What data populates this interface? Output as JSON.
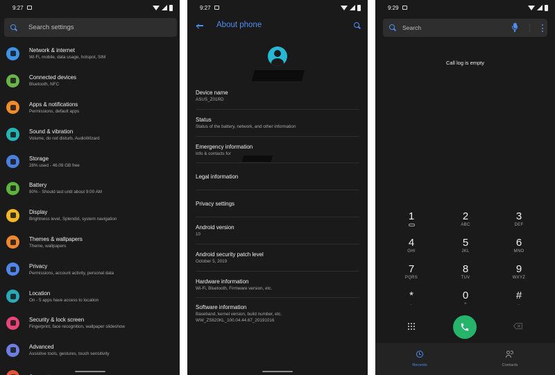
{
  "colors": {
    "background": "#1a1a1a",
    "accent": "#4d8ff0",
    "call_green": "#26b36a"
  },
  "settings_screen": {
    "status_time": "9:27",
    "search_placeholder": "Search settings",
    "items": [
      {
        "title": "Network & internet",
        "subtitle": "Wi-Fi, mobile, data usage, hotspot, SIM",
        "icon": "wifi-icon",
        "color": "#3d93e6"
      },
      {
        "title": "Connected devices",
        "subtitle": "Bluetooth, NFC",
        "icon": "devices-icon",
        "color": "#6bb34a"
      },
      {
        "title": "Apps & notifications",
        "subtitle": "Permissions, default apps",
        "icon": "apps-icon",
        "color": "#f08c2a"
      },
      {
        "title": "Sound & vibration",
        "subtitle": "Volume, do not disturb, AudioWizard",
        "icon": "volume-icon",
        "color": "#26b5b5"
      },
      {
        "title": "Storage",
        "subtitle": "28% used - 46.09 GB free",
        "icon": "storage-icon",
        "color": "#4a7fe0"
      },
      {
        "title": "Battery",
        "subtitle": "80% - Should last until about 9:00 AM",
        "icon": "battery-icon",
        "color": "#5cb63e"
      },
      {
        "title": "Display",
        "subtitle": "Brightness level, Splendid, system navigation",
        "icon": "brightness-icon",
        "color": "#f2b823"
      },
      {
        "title": "Themes & wallpapers",
        "subtitle": "Theme, wallpapers",
        "icon": "wallpaper-icon",
        "color": "#f0862e"
      },
      {
        "title": "Privacy",
        "subtitle": "Permissions, account activity, personal data",
        "icon": "privacy-icon",
        "color": "#4f86e8"
      },
      {
        "title": "Location",
        "subtitle": "On - 5 apps have access to location",
        "icon": "location-icon",
        "color": "#2aa9b8"
      },
      {
        "title": "Security & lock screen",
        "subtitle": "Fingerprint, face recognition, wallpaper slideshow",
        "icon": "lock-icon",
        "color": "#e8457a"
      },
      {
        "title": "Advanced",
        "subtitle": "Assistive tools, gestures, touch sensitivity",
        "icon": "advanced-icon",
        "color": "#6d7fe0"
      },
      {
        "title": "Accounts",
        "subtitle": "",
        "icon": "account-icon",
        "color": "#e0543a"
      }
    ]
  },
  "about_screen": {
    "status_time": "9:27",
    "title": "About phone",
    "items": [
      {
        "title": "Device name",
        "subtitle": "ASUS_Z01RD"
      },
      {
        "title": "Status",
        "subtitle": "Status of the battery, network, and other information"
      },
      {
        "title": "Emergency information",
        "subtitle": "Info & contacts for"
      },
      {
        "title": "Legal information",
        "subtitle": ""
      },
      {
        "title": "Privacy settings",
        "subtitle": ""
      },
      {
        "title": "Android version",
        "subtitle": "10"
      },
      {
        "title": "Android security patch level",
        "subtitle": "October 5, 2019"
      },
      {
        "title": "Hardware information",
        "subtitle": "Wi-Fi, Bluetooth, Firmware version, etc."
      },
      {
        "title": "Software information",
        "subtitle": "Baseband, kernel version, build number, etc.",
        "subtitle2": "WW_ZS620KL_100.04.44.67_20191016"
      }
    ]
  },
  "dialer_screen": {
    "status_time": "9:29",
    "search_placeholder": "Search",
    "empty_message": "Call log is empty",
    "keys": [
      {
        "digit": "1",
        "letters": ""
      },
      {
        "digit": "2",
        "letters": "ABC"
      },
      {
        "digit": "3",
        "letters": "DEF"
      },
      {
        "digit": "4",
        "letters": "GHI"
      },
      {
        "digit": "5",
        "letters": "JKL"
      },
      {
        "digit": "6",
        "letters": "MNO"
      },
      {
        "digit": "7",
        "letters": "PQRS"
      },
      {
        "digit": "8",
        "letters": "TUV"
      },
      {
        "digit": "9",
        "letters": "WXYZ"
      },
      {
        "digit": "*",
        "letters": "."
      },
      {
        "digit": "0",
        "letters": "+"
      },
      {
        "digit": "#",
        "letters": "."
      }
    ],
    "nav": {
      "recents": "Recents",
      "contacts": "Contacts"
    }
  }
}
